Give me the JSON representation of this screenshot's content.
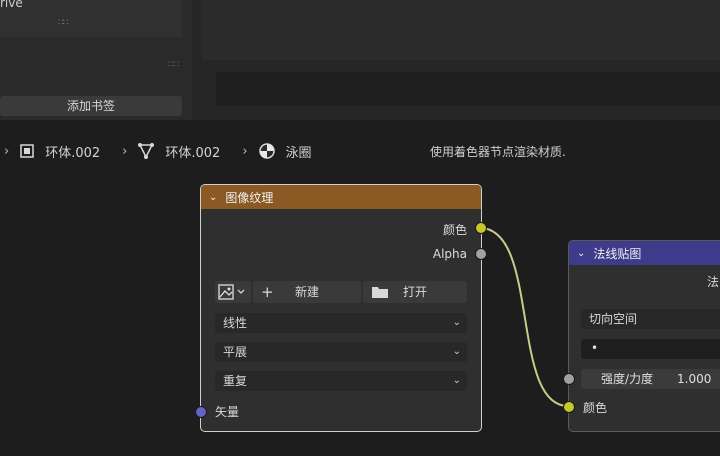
{
  "top_panel": {
    "drive_text": "rive",
    "bookmark_button": "添加书签"
  },
  "breadcrumb": {
    "items": [
      {
        "label": "环体.002",
        "icon": "object-square-icon"
      },
      {
        "label": "环体.002",
        "icon": "mesh-vertex-icon"
      },
      {
        "label": "泳圈",
        "icon": "material-sphere-icon"
      }
    ],
    "hint": "使用着色器节点渲染材质."
  },
  "image_node": {
    "title": "图像纹理",
    "outputs": [
      "颜色",
      "Alpha"
    ],
    "new_button": "新建",
    "open_button": "打开",
    "interpolation": "线性",
    "projection": "平展",
    "extension": "重复",
    "input": "矢量",
    "header_color": "#8b5a24"
  },
  "normal_node": {
    "title": "法线贴图",
    "top_label": "法",
    "space": "切向空间",
    "uv_field": "•",
    "strength_label": "强度/力度",
    "strength_value": "1.000",
    "color_input": "颜色",
    "header_color": "#3e3c8a"
  },
  "colors": {
    "wire": "#c9c98a",
    "socket_color": "#c7c729",
    "socket_vector": "#6363c7"
  }
}
